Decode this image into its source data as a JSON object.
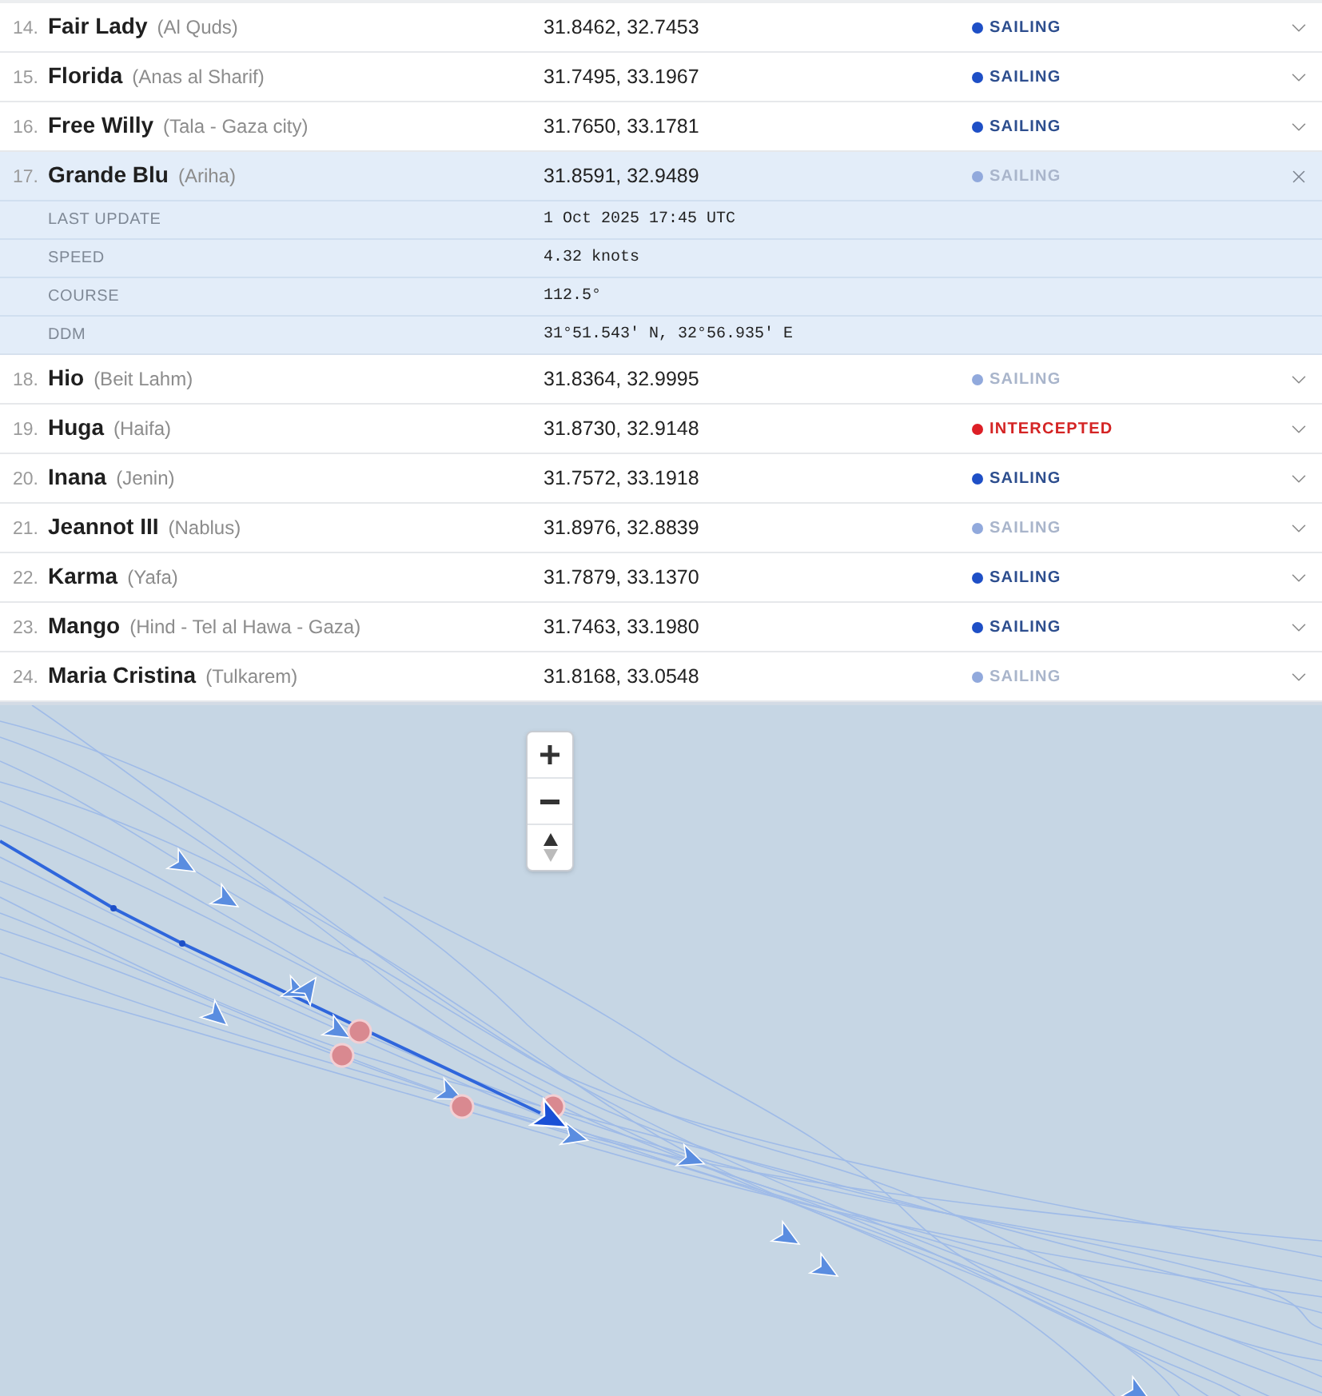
{
  "vessels": [
    {
      "number": "14.",
      "name": "Fair Lady",
      "origin": "(Al Quds)",
      "position": "31.8462, 32.7453",
      "status": {
        "label": "SAILING",
        "kind": "sailing",
        "color": "#1e4fc6"
      },
      "expanded": false
    },
    {
      "number": "15.",
      "name": "Florida",
      "origin": "(Anas al Sharif)",
      "position": "31.7495, 33.1967",
      "status": {
        "label": "SAILING",
        "kind": "sailing",
        "color": "#1e4fc6"
      },
      "expanded": false
    },
    {
      "number": "16.",
      "name": "Free Willy",
      "origin": "(Tala - Gaza city)",
      "position": "31.7650, 33.1781",
      "status": {
        "label": "SAILING",
        "kind": "sailing",
        "color": "#1e4fc6"
      },
      "expanded": false
    },
    {
      "number": "17.",
      "name": "Grande Blu",
      "origin": "(Ariha)",
      "position": "31.8591, 32.9489",
      "status": {
        "label": "SAILING",
        "kind": "stale",
        "color": "#91a9dc"
      },
      "expanded": true,
      "details": [
        {
          "label": "LAST UPDATE",
          "value": "1 Oct 2025 17:45 UTC"
        },
        {
          "label": "SPEED",
          "value": "4.32 knots"
        },
        {
          "label": "COURSE",
          "value": "112.5°"
        },
        {
          "label": "DDM",
          "value": "31°51.543′ N, 32°56.935′ E"
        }
      ]
    },
    {
      "number": "18.",
      "name": "Hio",
      "origin": "(Beit Lahm)",
      "position": "31.8364, 32.9995",
      "status": {
        "label": "SAILING",
        "kind": "stale",
        "color": "#91a9dc"
      },
      "expanded": false
    },
    {
      "number": "19.",
      "name": "Huga",
      "origin": "(Haifa)",
      "position": "31.8730, 32.9148",
      "status": {
        "label": "INTERCEPTED",
        "kind": "intercepted",
        "color": "#dd1f26"
      },
      "expanded": false
    },
    {
      "number": "20.",
      "name": "Inana",
      "origin": "(Jenin)",
      "position": "31.7572, 33.1918",
      "status": {
        "label": "SAILING",
        "kind": "sailing",
        "color": "#1e4fc6"
      },
      "expanded": false
    },
    {
      "number": "21.",
      "name": "Jeannot III",
      "origin": "(Nablus)",
      "position": "31.8976, 32.8839",
      "status": {
        "label": "SAILING",
        "kind": "stale",
        "color": "#91a9dc"
      },
      "expanded": false
    },
    {
      "number": "22.",
      "name": "Karma",
      "origin": "(Yafa)",
      "position": "31.7879, 33.1370",
      "status": {
        "label": "SAILING",
        "kind": "sailing",
        "color": "#1e4fc6"
      },
      "expanded": false
    },
    {
      "number": "23.",
      "name": "Mango",
      "origin": "(Hind - Tel al Hawa - Gaza)",
      "position": "31.7463, 33.1980",
      "status": {
        "label": "SAILING",
        "kind": "sailing",
        "color": "#1e4fc6"
      },
      "expanded": false
    },
    {
      "number": "24.",
      "name": "Maria Cristina",
      "origin": "(Tulkarem)",
      "position": "31.8168, 33.0548",
      "status": {
        "label": "SAILING",
        "kind": "stale",
        "color": "#91a9dc"
      },
      "expanded": false
    }
  ]
}
